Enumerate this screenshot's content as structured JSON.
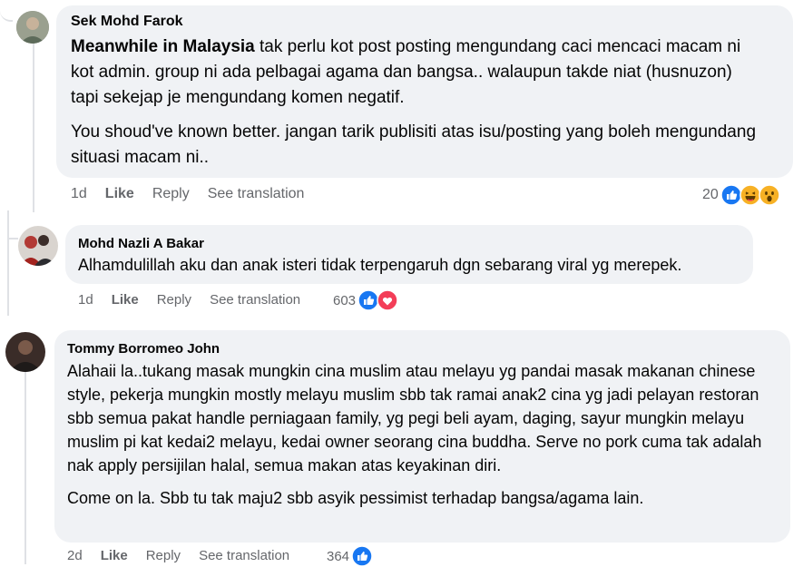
{
  "comments": [
    {
      "author": "Sek Mohd Farok",
      "body_bold": "Meanwhile in Malaysia",
      "body_p1": " tak perlu kot post posting mengundang caci mencaci macam ni kot admin. group ni ada pelbagai agama dan bangsa.. walaupun takde niat (husnuzon) tapi sekejap je mengundang komen negatif.",
      "body_p2": "You shoud've known better. jangan tarik publisiti atas isu/posting yang boleh mengundang situasi macam ni..",
      "time": "1d",
      "like": "Like",
      "reply": "Reply",
      "translate": "See translation",
      "reaction_count": "20",
      "reactions": [
        "like-icon",
        "haha-icon",
        "wow-icon"
      ]
    },
    {
      "author": "Mohd Nazli A Bakar",
      "body_p1": "Alhamdulillah aku dan anak isteri tidak terpengaruh dgn sebarang viral yg merepek.",
      "time": "1d",
      "like": "Like",
      "reply": "Reply",
      "translate": "See translation",
      "reaction_count": "603",
      "reactions": [
        "like-icon",
        "love-icon"
      ]
    },
    {
      "author": "Tommy Borromeo John",
      "body_p1": "Alahaii la..tukang masak mungkin cina muslim atau melayu yg pandai masak makanan chinese style, pekerja mungkin mostly melayu muslim sbb tak ramai anak2 cina yg jadi pelayan restoran sbb semua pakat handle perniagaan family, yg pegi beli ayam, daging, sayur mungkin melayu muslim pi kat kedai2 melayu, kedai owner seorang cina buddha. Serve no pork cuma tak adalah nak apply persijilan halal, semua makan atas keyakinan diri.",
      "body_p2": "Come on la. Sbb tu tak maju2 sbb asyik pessimist terhadap bangsa/agama lain.",
      "time": "2d",
      "like": "Like",
      "reply": "Reply",
      "translate": "See translation",
      "reaction_count": "364",
      "reactions": [
        "like-icon"
      ]
    }
  ],
  "colors": {
    "bubble": "#f0f2f5",
    "meta": "#65676b",
    "like_blue": "#1877f2",
    "love_red": "#f33e58",
    "emoji_yellow": "#f7b125"
  }
}
